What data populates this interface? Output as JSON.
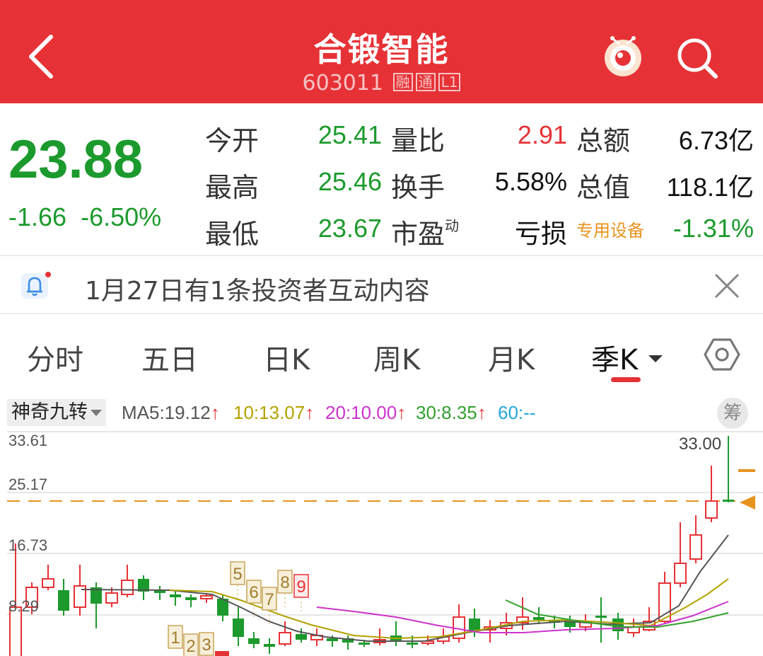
{
  "header": {
    "title": "合锻智能",
    "code": "603011",
    "tags": [
      "融",
      "通",
      "L1"
    ]
  },
  "quote": {
    "price": "23.88",
    "change": "-1.66",
    "change_pct": "-6.50%",
    "rows": [
      {
        "l1": "今开",
        "v1": "25.41",
        "l2": "量比",
        "v2": "2.91",
        "l3": "总额",
        "v3": "6.73亿"
      },
      {
        "l1": "最高",
        "v1": "25.46",
        "l2": "换手",
        "v2": "5.58%",
        "l3": "总值",
        "v3": "118.1亿"
      },
      {
        "l1": "最低",
        "v1": "23.67",
        "l2": "市盈",
        "l2_sup": "动",
        "v2": "亏损",
        "l3": "专用设备",
        "v3": "-1.31%"
      }
    ]
  },
  "notice": {
    "text": "1月27日有1条投资者互动内容"
  },
  "tabs": [
    "分时",
    "五日",
    "日K",
    "周K",
    "月K",
    "季K"
  ],
  "indicator": {
    "selector": "神奇九转",
    "ma5": "MA5:19.12",
    "ma10": "10:13.07",
    "ma20": "20:10.00",
    "ma30": "30:8.35",
    "ma60": "60:--",
    "chip_label": "筹"
  },
  "chart": {
    "y_labels": [
      "33.61",
      "25.17",
      "16.73",
      "8.29"
    ],
    "high_label": "33.00",
    "nine_turn_top": [
      "5",
      "6",
      "7",
      "8",
      "9"
    ],
    "nine_turn_bottom": [
      "1",
      "2",
      "3"
    ]
  },
  "colors": {
    "brand_red": "#e63236",
    "up_red": "#e63236",
    "down_green": "#1c9a2d",
    "industry_orange": "#e8931e",
    "ma5": "#555555",
    "ma10": "#b3a200",
    "ma20": "#cc33cc",
    "ma30": "#33a02c",
    "ma60": "#22a7d8"
  }
}
